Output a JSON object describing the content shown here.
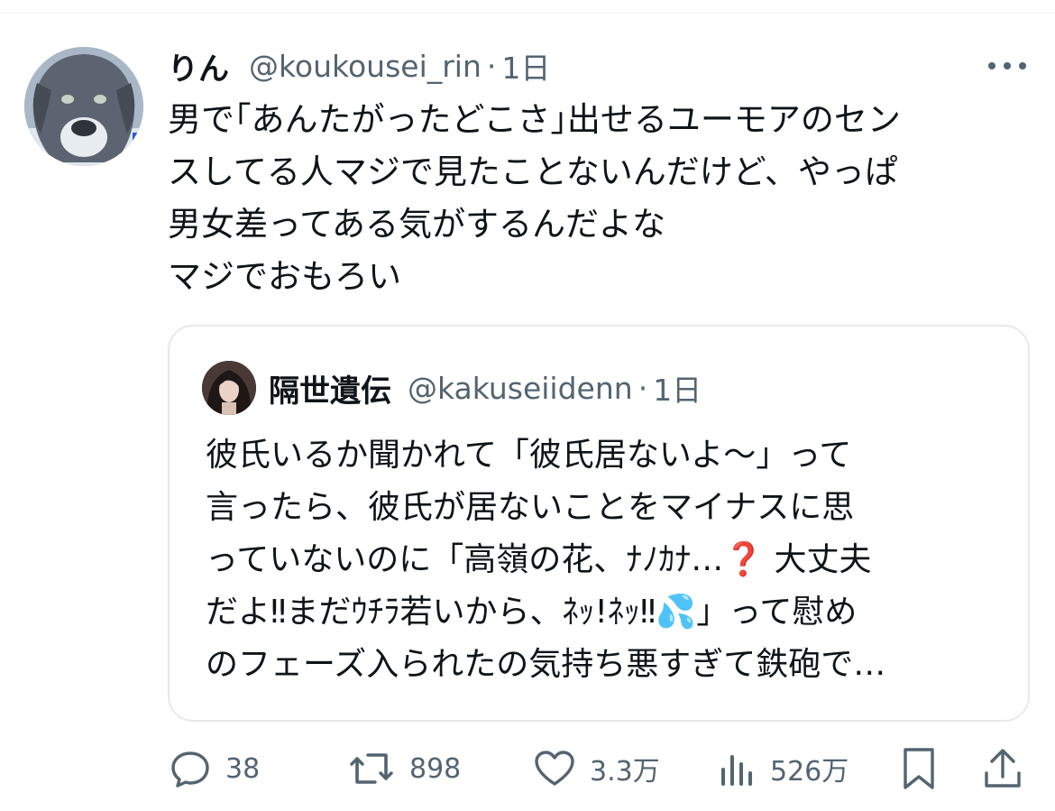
{
  "tweet": {
    "display_name": "りん",
    "handle": "@koukousei_rin",
    "separator": "·",
    "time": "1日",
    "text_lines": [
      "男で｢あんたがったどこさ｣出せるユーモアのセン",
      "スしてる人マジで見たことないんだけど、やっぱ",
      "男女差ってある気がするんだよな",
      "マジでおもろい"
    ]
  },
  "quote": {
    "display_name": "隔世遺伝",
    "handle": "@kakuseiidenn",
    "separator": "·",
    "time": "1日",
    "text_lines": [
      "彼氏いるか聞かれて「彼氏居ないよ〜」って",
      "言ったら、彼氏が居ないことをマイナスに思",
      "っていないのに「高嶺の花、ﾅﾉｶﾅ…❓ 大丈夫",
      "だよ‼︎まだｳﾁﾗ若いから、ﾈｯ!ﾈｯ‼︎💦」って慰め",
      "のフェーズ入られたの気持ち悪すぎて鉄砲で…"
    ]
  },
  "actions": {
    "reply_count": "38",
    "retweet_count": "898",
    "like_count": "3.3万",
    "views_count": "526万"
  },
  "colors": {
    "text": "#0f1419",
    "secondary": "#536471",
    "border": "#e7e9ea"
  },
  "icons": {
    "reply": "reply-icon",
    "retweet": "retweet-icon",
    "like": "heart-icon",
    "views": "views-icon",
    "bookmark": "bookmark-icon",
    "share": "share-icon",
    "more": "more-icon"
  }
}
